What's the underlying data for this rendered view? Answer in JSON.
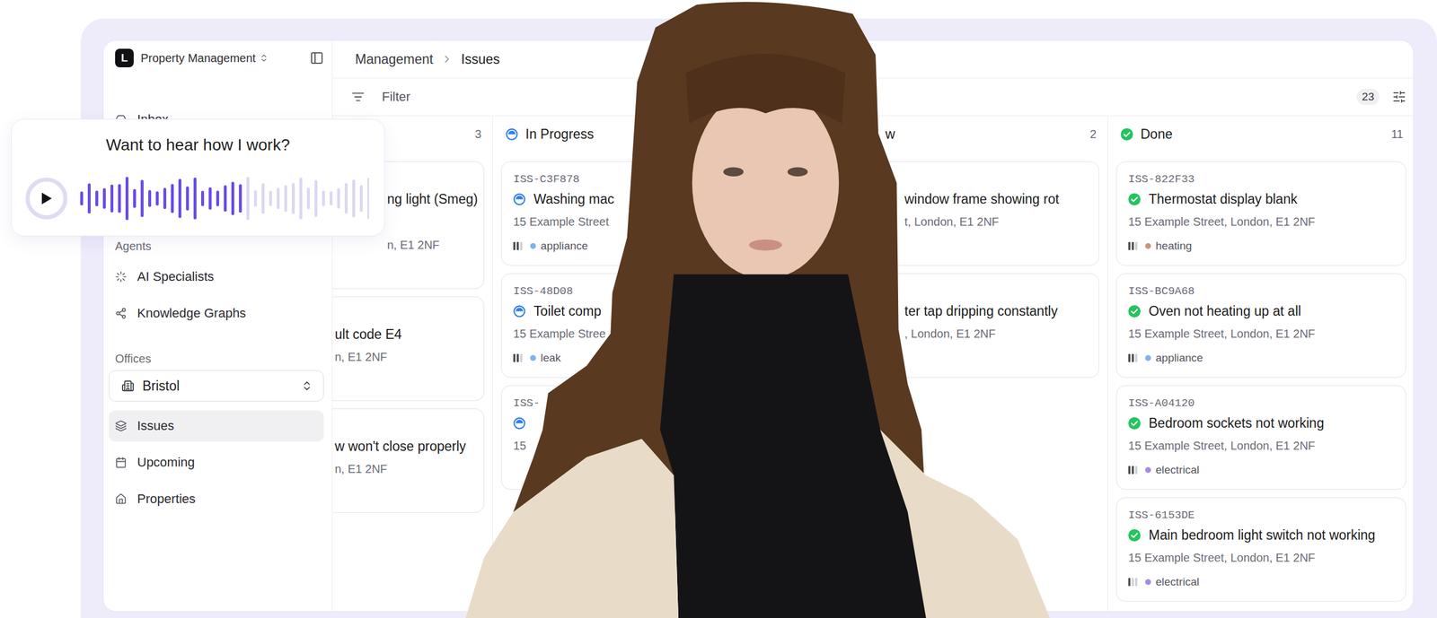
{
  "promo": {
    "title": "Want to hear how I work?",
    "level": 0.57
  },
  "sidebar": {
    "workspace": {
      "logo": "L",
      "name": "Property Management"
    },
    "top_items": [
      {
        "label": "Inbox",
        "selected": false
      }
    ],
    "agents": {
      "label": "Agents",
      "items": [
        {
          "label": "AI Specialists",
          "selected": false
        },
        {
          "label": "Knowledge Graphs",
          "selected": false
        }
      ]
    },
    "offices": {
      "label": "Offices",
      "select": "Bristol",
      "items": [
        {
          "label": "Issues",
          "selected": true
        },
        {
          "label": "Upcoming",
          "selected": false
        },
        {
          "label": "Properties",
          "selected": false
        }
      ]
    }
  },
  "breadcrumb": [
    "Management",
    "Issues"
  ],
  "toolbar": {
    "filter": "Filter",
    "count": "23"
  },
  "columns": [
    {
      "kind": "clipped",
      "count": "3",
      "cards": [
        {
          "title": "ng light (Smeg)",
          "address": "n, E1 2NF"
        },
        {
          "title": "ult code E4",
          "address": "n, E1 2NF"
        },
        {
          "title": "w won't close properly",
          "address": "n, E1 2NF"
        }
      ]
    },
    {
      "kind": "covered-right",
      "title": "In Progress",
      "status": "in-progress",
      "cards": [
        {
          "id": "ISS-C3F878",
          "title": "Washing mac",
          "address": "15 Example Street",
          "tag": "appliance",
          "color": "#7db4ec",
          "priority": 2
        },
        {
          "id": "ISS-48D08",
          "title": "Toilet comp",
          "address": "15 Example Stree",
          "tag": "leak",
          "color": "#7db4ec",
          "priority": 2
        },
        {
          "id": "ISS-",
          "title": "",
          "address": "15"
        }
      ]
    },
    {
      "kind": "covered-left",
      "title": "w",
      "count": "2",
      "cards": [
        {
          "title": "window frame showing rot",
          "address": "t, London, E1 2NF"
        },
        {
          "title": "ter tap dripping constantly",
          "address": ", London, E1 2NF"
        }
      ]
    },
    {
      "kind": "plain",
      "title": "Done",
      "status": "done",
      "count": "11",
      "cards": [
        {
          "id": "ISS-822F33",
          "title": "Thermostat display blank",
          "address": "15 Example Street, London, E1 2NF",
          "tag": "heating",
          "color": "#c9967a",
          "priority": 2
        },
        {
          "id": "ISS-BC9A68",
          "title": "Oven not heating up at all",
          "address": "15 Example Street, London, E1 2NF",
          "tag": "appliance",
          "color": "#7db4ec",
          "priority": 2
        },
        {
          "id": "ISS-A04120",
          "title": "Bedroom sockets not working",
          "address": "15 Example Street, London, E1 2NF",
          "tag": "electrical",
          "color": "#a48bea",
          "priority": 2
        },
        {
          "id": "ISS-6153DE",
          "title": "Main bedroom light switch not working",
          "address": "15 Example Street, London, E1 2NF",
          "tag": "electrical",
          "color": "#a48bea",
          "priority": 1
        }
      ]
    }
  ]
}
